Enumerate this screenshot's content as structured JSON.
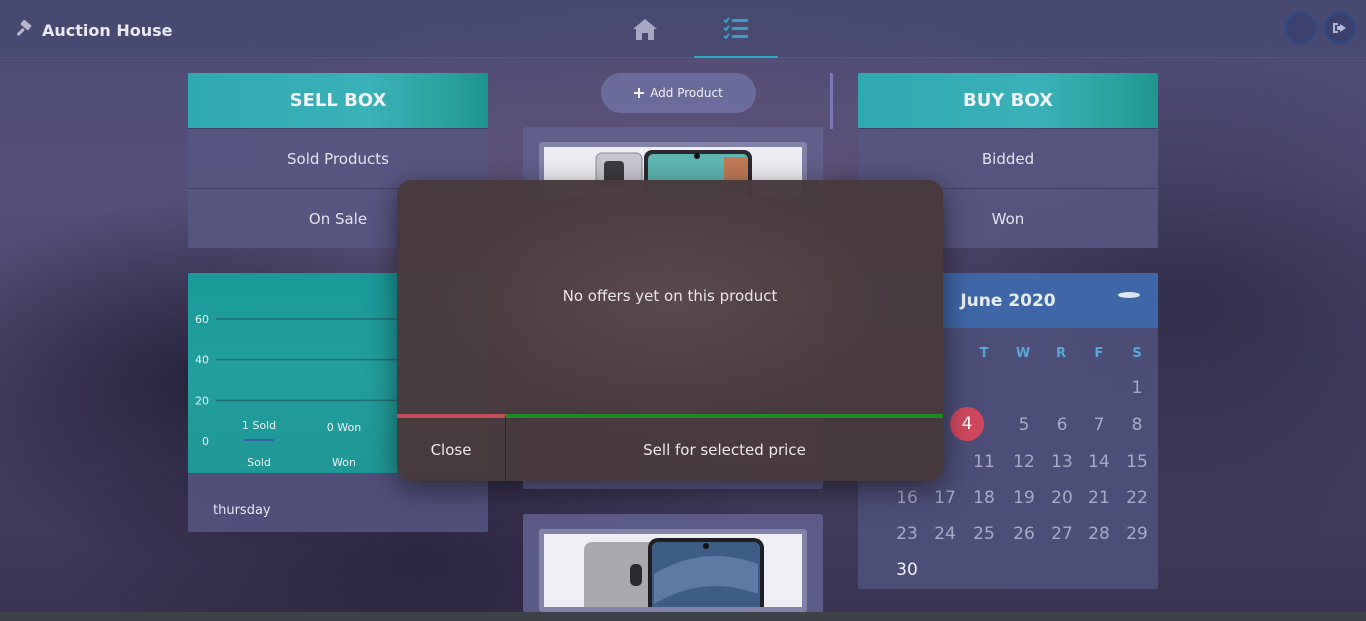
{
  "app": {
    "title": "Auction House"
  },
  "sell_box": {
    "title": "SELL BOX",
    "items": [
      "Sold Products",
      "On Sale"
    ]
  },
  "buy_box": {
    "title": "BUY BOX",
    "items": [
      "Bidded",
      "Won"
    ]
  },
  "add_product": {
    "label": "Add Product"
  },
  "stats": {
    "footer": "thursday",
    "chart_data": {
      "type": "bar",
      "categories": [
        "Sold",
        "Won"
      ],
      "values": [
        1,
        0
      ],
      "data_labels": [
        "1 Sold",
        "0 Won"
      ],
      "yticks": [
        0,
        20,
        40,
        60
      ],
      "ylim": [
        0,
        60
      ],
      "grid": true
    }
  },
  "calendar": {
    "title": "June 2020",
    "weekdays": [
      "T",
      "W",
      "R",
      "F",
      "S"
    ],
    "weeks": [
      [
        "",
        "",
        "",
        "",
        "1"
      ],
      [
        "4",
        "5",
        "6",
        "7",
        "8"
      ],
      [
        "",
        "11",
        "12",
        "13",
        "14",
        "15"
      ],
      [
        "16",
        "17",
        "18",
        "19",
        "20",
        "21",
        "22"
      ],
      [
        "23",
        "24",
        "25",
        "26",
        "27",
        "28",
        "29"
      ],
      [
        "30"
      ]
    ],
    "today": "4"
  },
  "modal": {
    "message": "No offers yet on this product",
    "close_label": "Close",
    "sell_label": "Sell for selected price"
  },
  "colors": {
    "accent": "#2fa9b0",
    "danger": "#c44d5a",
    "success": "#1f8a22",
    "today": "#d0485e"
  }
}
